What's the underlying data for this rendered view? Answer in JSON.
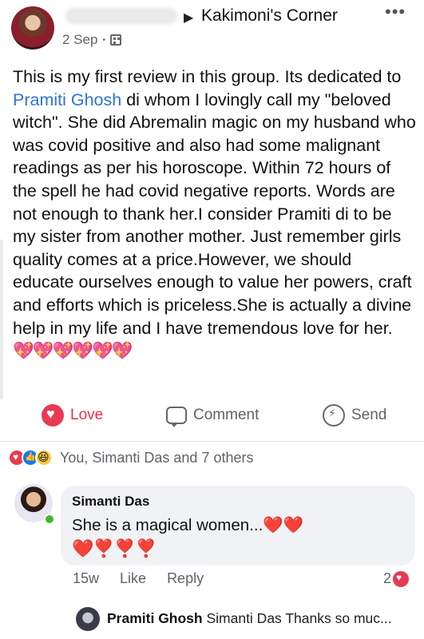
{
  "post": {
    "group_name": "Kakimoni's Corner",
    "more": "•••",
    "date": "2 Sep",
    "text_before_link": "This is my first review in this group. Its dedicated to ",
    "linked_name": "Pramiti Ghosh",
    "text_after_link": " di whom I lovingly call my \"beloved witch\". She did Abremalin magic on my husband who was covid positive and also had some malignant readings as per his horoscope. Within 72 hours of the spell he had covid negative reports. Words are not enough to thank her.I consider Pramiti di to be my sister from another mother. Just remember girls quality comes at a price.However, we should educate ourselves enough to value her powers, craft and efforts which is priceless.She is actually a divine help in my life and I have tremendous love for her. ",
    "hearts": "💖💖💖💖💖💖"
  },
  "actions": {
    "love": "Love",
    "comment": "Comment",
    "send": "Send"
  },
  "reactions": {
    "summary": "You, Simanti Das and 7 others"
  },
  "comment": {
    "author": "Simanti Das",
    "line1": "She is a magical women...❤️❤️",
    "line2": "❤️❣️❣️❣️",
    "time": "15w",
    "like": "Like",
    "reply": "Reply",
    "reaction_count": "2"
  },
  "reply": {
    "author": "Pramiti Ghosh",
    "text": " Simanti Das Thanks so muc..."
  },
  "colors": {
    "link": "#2e74d9",
    "love": "#e83a52",
    "like": "#1877f2",
    "online": "#42b72a"
  }
}
